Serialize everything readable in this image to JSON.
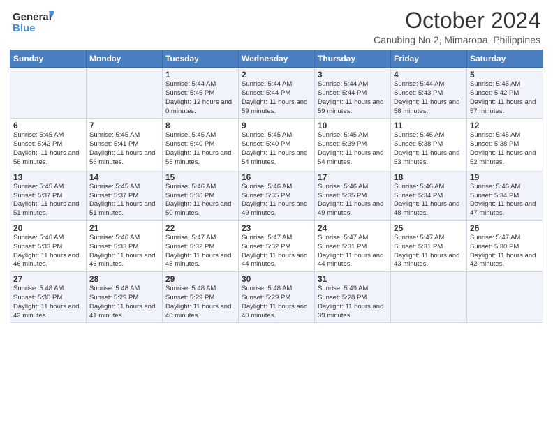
{
  "logo": {
    "line1": "General",
    "line2": "Blue"
  },
  "title": "October 2024",
  "subtitle": "Canubing No 2, Mimaropa, Philippines",
  "days_of_week": [
    "Sunday",
    "Monday",
    "Tuesday",
    "Wednesday",
    "Thursday",
    "Friday",
    "Saturday"
  ],
  "weeks": [
    [
      {
        "day": "",
        "detail": ""
      },
      {
        "day": "",
        "detail": ""
      },
      {
        "day": "1",
        "detail": "Sunrise: 5:44 AM\nSunset: 5:45 PM\nDaylight: 12 hours and 0 minutes."
      },
      {
        "day": "2",
        "detail": "Sunrise: 5:44 AM\nSunset: 5:44 PM\nDaylight: 11 hours and 59 minutes."
      },
      {
        "day": "3",
        "detail": "Sunrise: 5:44 AM\nSunset: 5:44 PM\nDaylight: 11 hours and 59 minutes."
      },
      {
        "day": "4",
        "detail": "Sunrise: 5:44 AM\nSunset: 5:43 PM\nDaylight: 11 hours and 58 minutes."
      },
      {
        "day": "5",
        "detail": "Sunrise: 5:45 AM\nSunset: 5:42 PM\nDaylight: 11 hours and 57 minutes."
      }
    ],
    [
      {
        "day": "6",
        "detail": "Sunrise: 5:45 AM\nSunset: 5:42 PM\nDaylight: 11 hours and 56 minutes."
      },
      {
        "day": "7",
        "detail": "Sunrise: 5:45 AM\nSunset: 5:41 PM\nDaylight: 11 hours and 56 minutes."
      },
      {
        "day": "8",
        "detail": "Sunrise: 5:45 AM\nSunset: 5:40 PM\nDaylight: 11 hours and 55 minutes."
      },
      {
        "day": "9",
        "detail": "Sunrise: 5:45 AM\nSunset: 5:40 PM\nDaylight: 11 hours and 54 minutes."
      },
      {
        "day": "10",
        "detail": "Sunrise: 5:45 AM\nSunset: 5:39 PM\nDaylight: 11 hours and 54 minutes."
      },
      {
        "day": "11",
        "detail": "Sunrise: 5:45 AM\nSunset: 5:38 PM\nDaylight: 11 hours and 53 minutes."
      },
      {
        "day": "12",
        "detail": "Sunrise: 5:45 AM\nSunset: 5:38 PM\nDaylight: 11 hours and 52 minutes."
      }
    ],
    [
      {
        "day": "13",
        "detail": "Sunrise: 5:45 AM\nSunset: 5:37 PM\nDaylight: 11 hours and 51 minutes."
      },
      {
        "day": "14",
        "detail": "Sunrise: 5:45 AM\nSunset: 5:37 PM\nDaylight: 11 hours and 51 minutes."
      },
      {
        "day": "15",
        "detail": "Sunrise: 5:46 AM\nSunset: 5:36 PM\nDaylight: 11 hours and 50 minutes."
      },
      {
        "day": "16",
        "detail": "Sunrise: 5:46 AM\nSunset: 5:35 PM\nDaylight: 11 hours and 49 minutes."
      },
      {
        "day": "17",
        "detail": "Sunrise: 5:46 AM\nSunset: 5:35 PM\nDaylight: 11 hours and 49 minutes."
      },
      {
        "day": "18",
        "detail": "Sunrise: 5:46 AM\nSunset: 5:34 PM\nDaylight: 11 hours and 48 minutes."
      },
      {
        "day": "19",
        "detail": "Sunrise: 5:46 AM\nSunset: 5:34 PM\nDaylight: 11 hours and 47 minutes."
      }
    ],
    [
      {
        "day": "20",
        "detail": "Sunrise: 5:46 AM\nSunset: 5:33 PM\nDaylight: 11 hours and 46 minutes."
      },
      {
        "day": "21",
        "detail": "Sunrise: 5:46 AM\nSunset: 5:33 PM\nDaylight: 11 hours and 46 minutes."
      },
      {
        "day": "22",
        "detail": "Sunrise: 5:47 AM\nSunset: 5:32 PM\nDaylight: 11 hours and 45 minutes."
      },
      {
        "day": "23",
        "detail": "Sunrise: 5:47 AM\nSunset: 5:32 PM\nDaylight: 11 hours and 44 minutes."
      },
      {
        "day": "24",
        "detail": "Sunrise: 5:47 AM\nSunset: 5:31 PM\nDaylight: 11 hours and 44 minutes."
      },
      {
        "day": "25",
        "detail": "Sunrise: 5:47 AM\nSunset: 5:31 PM\nDaylight: 11 hours and 43 minutes."
      },
      {
        "day": "26",
        "detail": "Sunrise: 5:47 AM\nSunset: 5:30 PM\nDaylight: 11 hours and 42 minutes."
      }
    ],
    [
      {
        "day": "27",
        "detail": "Sunrise: 5:48 AM\nSunset: 5:30 PM\nDaylight: 11 hours and 42 minutes."
      },
      {
        "day": "28",
        "detail": "Sunrise: 5:48 AM\nSunset: 5:29 PM\nDaylight: 11 hours and 41 minutes."
      },
      {
        "day": "29",
        "detail": "Sunrise: 5:48 AM\nSunset: 5:29 PM\nDaylight: 11 hours and 40 minutes."
      },
      {
        "day": "30",
        "detail": "Sunrise: 5:48 AM\nSunset: 5:29 PM\nDaylight: 11 hours and 40 minutes."
      },
      {
        "day": "31",
        "detail": "Sunrise: 5:49 AM\nSunset: 5:28 PM\nDaylight: 11 hours and 39 minutes."
      },
      {
        "day": "",
        "detail": ""
      },
      {
        "day": "",
        "detail": ""
      }
    ]
  ]
}
